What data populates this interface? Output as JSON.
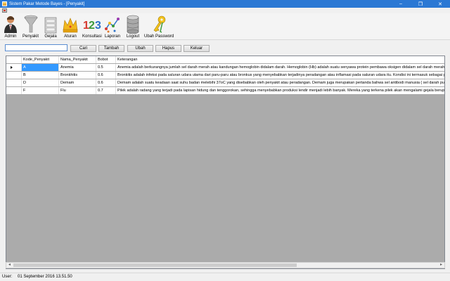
{
  "window": {
    "title": "Sistem Pakar Metode Bayes - [Penyakit]",
    "minimize": "–",
    "maximize": "❐",
    "close": "✕"
  },
  "toolbar": {
    "items": [
      {
        "label": "Admin",
        "icon": "admin-user-icon"
      },
      {
        "label": "Penyakit",
        "icon": "funnel-icon"
      },
      {
        "label": "Gejala",
        "icon": "cabinet-icon"
      },
      {
        "label": "Aturan",
        "icon": "crown-icon"
      },
      {
        "label": "Konsultasi",
        "icon": "numbers-123-icon"
      },
      {
        "label": "Laporan",
        "icon": "chart-icon"
      },
      {
        "label": "Logout",
        "icon": "database-icon"
      },
      {
        "label": "Ubah Password",
        "icon": "keys-icon"
      }
    ]
  },
  "search": {
    "value": "",
    "placeholder": ""
  },
  "buttons": {
    "cari": "Cari",
    "tambah": "Tambah",
    "ubah": "Ubah",
    "hapus": "Hapus",
    "keluar": "Keluar"
  },
  "table": {
    "columns": [
      "Kode_Penyakit",
      "Nama_Penyakit",
      "Bobot",
      "Keterangan"
    ],
    "rows": [
      [
        "A",
        "Anemia",
        "0.5",
        "Anemia adalah berkurangnya jumlah sel darah merah atau kandungan hemoglobin didalam darah. Hemoglobin (Hb) adalah suatu senyawa protein pembawa oksigen didalam sel darah merah. Sel darah"
      ],
      [
        "B",
        "Bronkhitis",
        "0.6",
        "Bronkitis adalah infeksi pada saluran udara utama dari paru-paru atau bronkus yang menyebabkan terjadinya peradangan atau inflamasi pada saluran udara itu. Kondisi ini termasuk sebagai penyakit"
      ],
      [
        "D",
        "Demam",
        "0.6",
        "Demam adalah suatu keadaan saat suhu badan melebihi 37oC yang disebabkan oleh penyakit atau peradangan. Demam juga merupakan pertanda bahwa sel antibodi manusia ( sel darah putih ) sedang"
      ],
      [
        "F",
        "Flu",
        "0.7",
        "Pilek adalah radang yang terjadi pada lapisan hidung dan tenggorokan, sehingga menyebabkan produksi lendir menjadi lebih banyak. Mereka yang terkena pilek akan mengalami gejala berupa nyeri"
      ]
    ],
    "selected_row": 0
  },
  "status": {
    "user_label": "User:",
    "datetime": "01 September 2016 13.51.50"
  }
}
